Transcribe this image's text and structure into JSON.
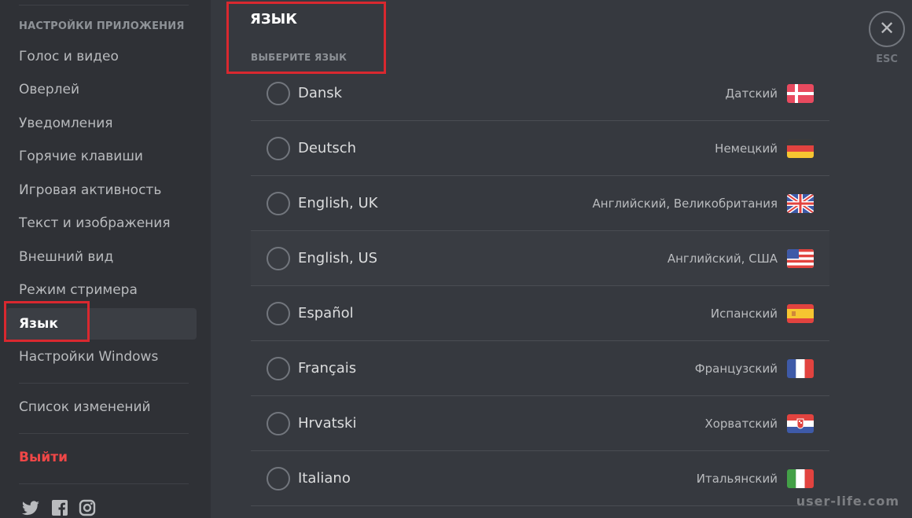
{
  "sidebar": {
    "section_header": "НАСТРОЙКИ ПРИЛОЖЕНИЯ",
    "items": [
      {
        "label": "Голос и видео"
      },
      {
        "label": "Оверлей"
      },
      {
        "label": "Уведомления"
      },
      {
        "label": "Горячие клавиши"
      },
      {
        "label": "Игровая активность"
      },
      {
        "label": "Текст и изображения"
      },
      {
        "label": "Внешний вид"
      },
      {
        "label": "Режим стримера"
      },
      {
        "label": "Язык",
        "selected": true
      },
      {
        "label": "Настройки Windows"
      }
    ],
    "changelog": "Список изменений",
    "logout": "Выйти",
    "social_icons": [
      "twitter-icon",
      "facebook-icon",
      "instagram-icon"
    ]
  },
  "main": {
    "title": "ЯЗЫК",
    "subtitle": "ВЫБЕРИТЕ ЯЗЫК",
    "languages": [
      {
        "native": "Dansk",
        "local": "Датский",
        "flag": "denmark-flag-icon"
      },
      {
        "native": "Deutsch",
        "local": "Немецкий",
        "flag": "germany-flag-icon"
      },
      {
        "native": "English, UK",
        "local": "Английский, Великобритания",
        "flag": "uk-flag-icon"
      },
      {
        "native": "English, US",
        "local": "Английский, США",
        "flag": "us-flag-icon"
      },
      {
        "native": "Español",
        "local": "Испанский",
        "flag": "spain-flag-icon"
      },
      {
        "native": "Français",
        "local": "Французский",
        "flag": "france-flag-icon"
      },
      {
        "native": "Hrvatski",
        "local": "Хорватский",
        "flag": "croatia-flag-icon"
      },
      {
        "native": "Italiano",
        "local": "Итальянский",
        "flag": "italy-flag-icon"
      }
    ]
  },
  "close": {
    "label": "ESC",
    "icon": "close-icon"
  },
  "watermark": "user-life.com",
  "colors": {
    "background": "#36393f",
    "sidebar": "#2f3136",
    "highlight_box": "#d9282f",
    "logout": "#f04747"
  }
}
